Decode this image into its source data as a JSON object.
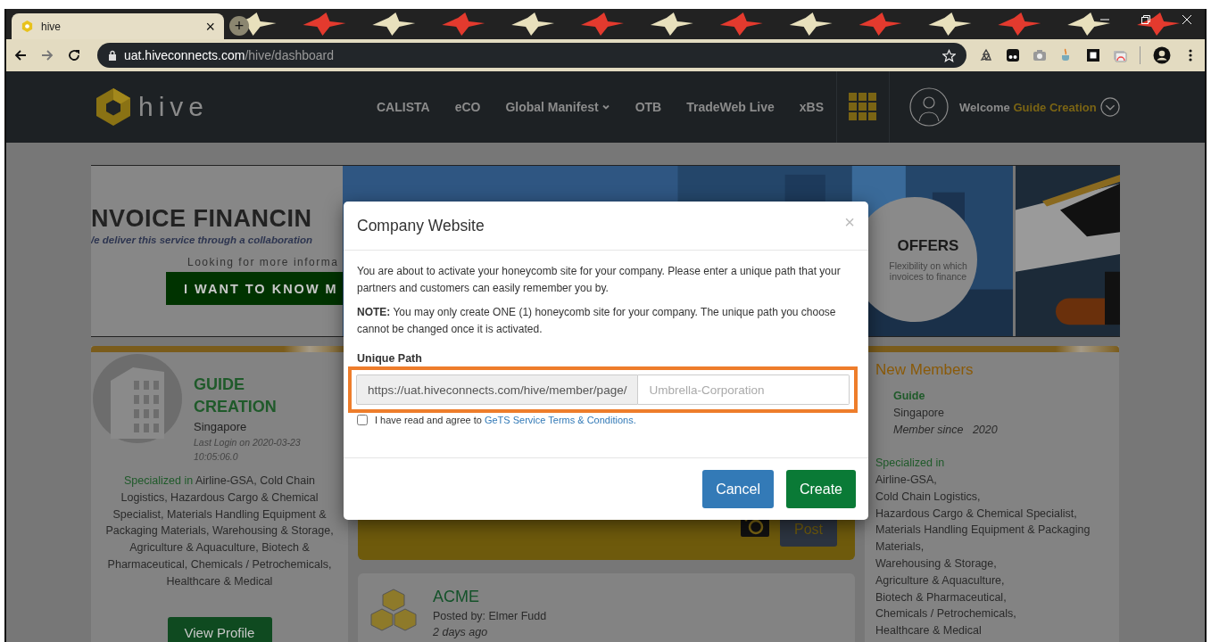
{
  "browser": {
    "tab": {
      "title": "hive",
      "close": "×"
    },
    "new_tab": "+",
    "url_host": "uat.hiveconnects.com",
    "url_path": "/hive/dashboard"
  },
  "nav": {
    "logo": "hive",
    "items": [
      {
        "label": "CALISTA",
        "dropdown": false
      },
      {
        "label": "eCO",
        "dropdown": false
      },
      {
        "label": "Global Manifest",
        "dropdown": true
      },
      {
        "label": "OTB",
        "dropdown": false
      },
      {
        "label": "TradeWeb Live",
        "dropdown": false
      },
      {
        "label": "xBS",
        "dropdown": false
      }
    ],
    "welcome": "Welcome",
    "user": "Guide Creation"
  },
  "banner": {
    "headline": "NVOICE FINANCIN",
    "tagline": "/e deliver this service through a collaboration",
    "prompt": "Looking for more informa",
    "button": "I WANT TO KNOW M",
    "offers_title": "OFFERS",
    "offers_text": "Flexibility on which invoices to finance"
  },
  "profile": {
    "name": "GUIDE CREATION",
    "location": "Singapore",
    "last_login": "Last Login on  2020-03-23 10:05:06.0",
    "specialized_label": "Specialized in",
    "specialized": "Airline-GSA, Cold Chain Logistics, Hazardous Cargo & Chemical Specialist, Materials Handling Equipment & Packaging Materials, Warehousing & Storage, Agriculture & Aquaculture, Biotech & Pharmaceutical, Chemicals / Petrochemicals, Healthcare & Medical",
    "button": "View Profile"
  },
  "composer": {
    "button": "Post"
  },
  "post": {
    "author": "ACME",
    "posted_by": "Posted by: Elmer Fudd",
    "time": "2 days ago"
  },
  "new_members": {
    "title": "New Members",
    "member": {
      "name": "Guide",
      "location": "Singapore",
      "since": "Member since   2020"
    },
    "specialized_label": "Specialized in",
    "specialties": [
      "Airline-GSA,",
      "Cold Chain Logistics,",
      "Hazardous Cargo & Chemical Specialist,",
      "Materials Handling Equipment & Packaging",
      "Materials,",
      "Warehousing & Storage,",
      "Agriculture & Aquaculture,",
      "Biotech & Pharmaceutical,",
      "Chemicals / Petrochemicals,",
      "Healthcare & Medical"
    ]
  },
  "modal": {
    "title": "Company Website",
    "close": "×",
    "intro": "You are about to activate your honeycomb site for your company. Please enter a unique path that your partners and customers can easily remember you by.",
    "note": "**NOTE:** You may only create ONE (1) honeycomb site for your company. The unique path you choose cannot be changed once it is activated.",
    "field_label": "Unique Path",
    "prefix": "https://uat.hiveconnects.com/hive/member/page/",
    "placeholder": "Umbrella-Corporation",
    "highlighted": true,
    "agree_checked": false,
    "agree_text": "I have read and agree to",
    "agree_link": "GeTS Service Terms & Conditions.",
    "buttons": [
      {
        "label": "Cancel",
        "kind": "secondary"
      },
      {
        "label": "Create",
        "kind": "primary"
      }
    ]
  }
}
